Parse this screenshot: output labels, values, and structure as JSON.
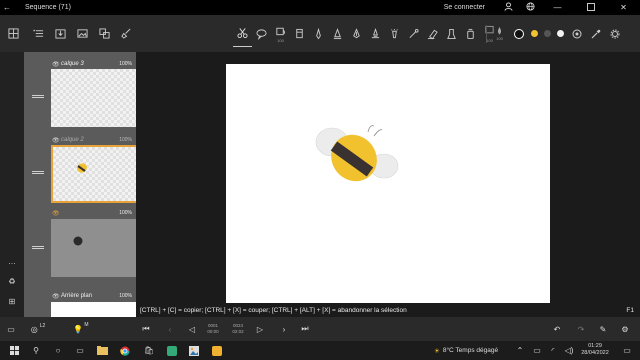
{
  "window": {
    "title": "Sequence (71)",
    "signin": "Se connecter"
  },
  "layers": [
    {
      "name": "calque 3",
      "opacity": "100%"
    },
    {
      "name": "calque 2",
      "opacity": "100%"
    },
    {
      "name": "",
      "opacity": "100%"
    },
    {
      "name": "Arrière plan",
      "opacity": "100%"
    }
  ],
  "toolbar": {
    "tool_sub_1": "100",
    "brush_size": "100"
  },
  "status": {
    "message": "[CTRL] + [C] = copier; [CTRL] + [X] = couper; [CTRL] + [ALT] + [X] = abandonner la sélection",
    "shortcut": "F1"
  },
  "timeline": {
    "frame_current": "0001",
    "frame_current_time": "00:00",
    "frame_total": "0024",
    "frame_total_time": "02:02",
    "l2_label": "L2",
    "m_label": "M"
  },
  "taskbar": {
    "weather": "8°C  Temps dégagé",
    "time": "01:29",
    "date": "28/04/2022"
  },
  "colors": {
    "accent_orange": "#e8a23a",
    "bee_yellow": "#f2c12e",
    "bee_stripe": "#3a3230",
    "color_swatch_1": "#f1c232"
  }
}
